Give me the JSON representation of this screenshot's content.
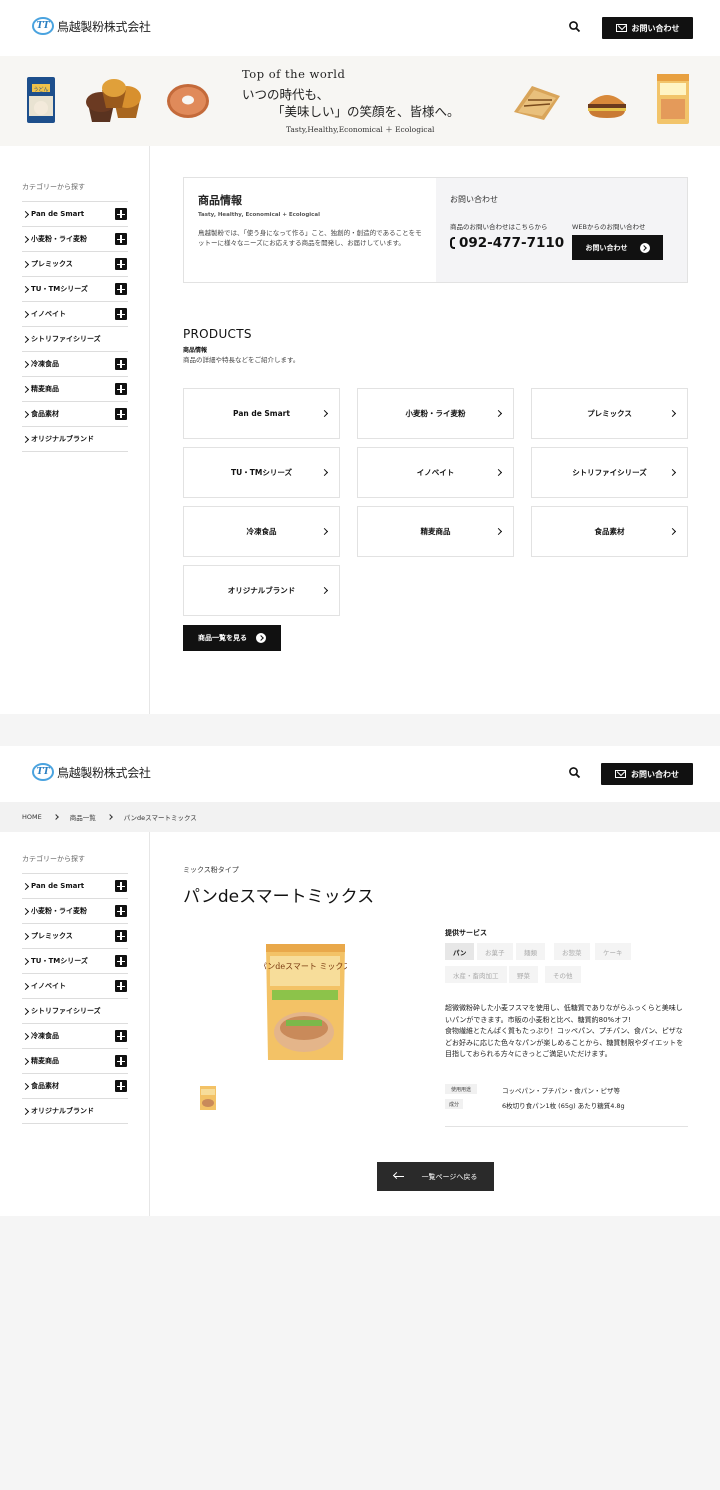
{
  "header": {
    "company_name": "鳥越製粉株式会社",
    "logo_mark": "TT",
    "contact_label": "お問い合わせ"
  },
  "banner": {
    "line1": "Top of the world",
    "line2": "いつの時代も、",
    "line3": "「美味しい」の笑顔を、皆様へ。",
    "line4": "Tasty,Healthy,Economical ＋ Ecological",
    "package_text": "うどん"
  },
  "sidebar": {
    "title": "カテゴリーから探す",
    "items": [
      {
        "label": "Pan de Smart",
        "expandable": true
      },
      {
        "label": "小麦粉・ライ麦粉",
        "expandable": true
      },
      {
        "label": "プレミックス",
        "expandable": true
      },
      {
        "label": "TU・TMシリーズ",
        "expandable": true
      },
      {
        "label": "イノベイト",
        "expandable": true
      },
      {
        "label": "シトリファイシリーズ",
        "expandable": false
      },
      {
        "label": "冷凍食品",
        "expandable": true
      },
      {
        "label": "精麦商品",
        "expandable": true
      },
      {
        "label": "食品素材",
        "expandable": true
      },
      {
        "label": "オリジナルブランド",
        "expandable": false
      }
    ]
  },
  "info": {
    "title": "商品情報",
    "subtitle": "Tasty, Healthy, Economical + Ecological",
    "description": "鳥越製粉では、「使う身になって作る」こと、独創的・創造的であることをモットーに様々なニーズにお応えする商品を開発し、お届けしています。",
    "contact_title": "お問い合わせ",
    "phone_label": "商品のお問い合わせはこちらから",
    "phone": "092-477-7110",
    "web_label": "WEBからのお問い合わせ",
    "web_button": "お問い合わせ"
  },
  "products": {
    "title": "PRODUCTS",
    "subtitle": "商品情報",
    "description": "商品の詳細や特長などをご紹介します。",
    "cards": [
      "Pan de Smart",
      "小麦粉・ライ麦粉",
      "プレミックス",
      "TU・TMシリーズ",
      "イノベイト",
      "シトリファイシリーズ",
      "冷凍食品",
      "精麦商品",
      "食品素材",
      "オリジナルブランド"
    ],
    "all_button": "商品一覧を見る"
  },
  "breadcrumb": [
    "HOME",
    "商品一覧",
    "パンdeスマートミックス"
  ],
  "detail": {
    "type": "ミックス粉タイプ",
    "title": "パンdeスマートミックス",
    "package_label": "パンdeスマート ミックス",
    "service_heading": "提供サービス",
    "service_tags": [
      {
        "label": "パン",
        "active": true
      },
      {
        "label": "お菓子",
        "active": false
      },
      {
        "label": "麺類",
        "active": false
      },
      {
        "label": "お惣菜",
        "active": false
      },
      {
        "label": "ケーキ",
        "active": false
      },
      {
        "label": "水産・畜肉加工",
        "active": false
      },
      {
        "label": "野菜",
        "active": false
      },
      {
        "label": "その他",
        "active": false
      }
    ],
    "description": "超微微粉砕した小麦フスマを使用し、低糖質でありながらふっくらと美味しいパンができます。市販の小麦粉と比べ、糖質約80%オフ!\n食物繊維とたんぱく質もたっぷり！コッペパン、プチパン、食パン、ピザなどお好みに応じた色々なパンが楽しめることから、糖質制限やダイエットを目指しておられる方々にきっとご満足いただけます。",
    "specs": [
      {
        "label": "使用用途",
        "value": "コッペパン・プチパン・食パン・ピザ等"
      },
      {
        "label": "成分",
        "value": "6枚切り食パン1枚 (65g) あたり糖質4.8g"
      }
    ],
    "back_button": "一覧ページへ戻る"
  }
}
